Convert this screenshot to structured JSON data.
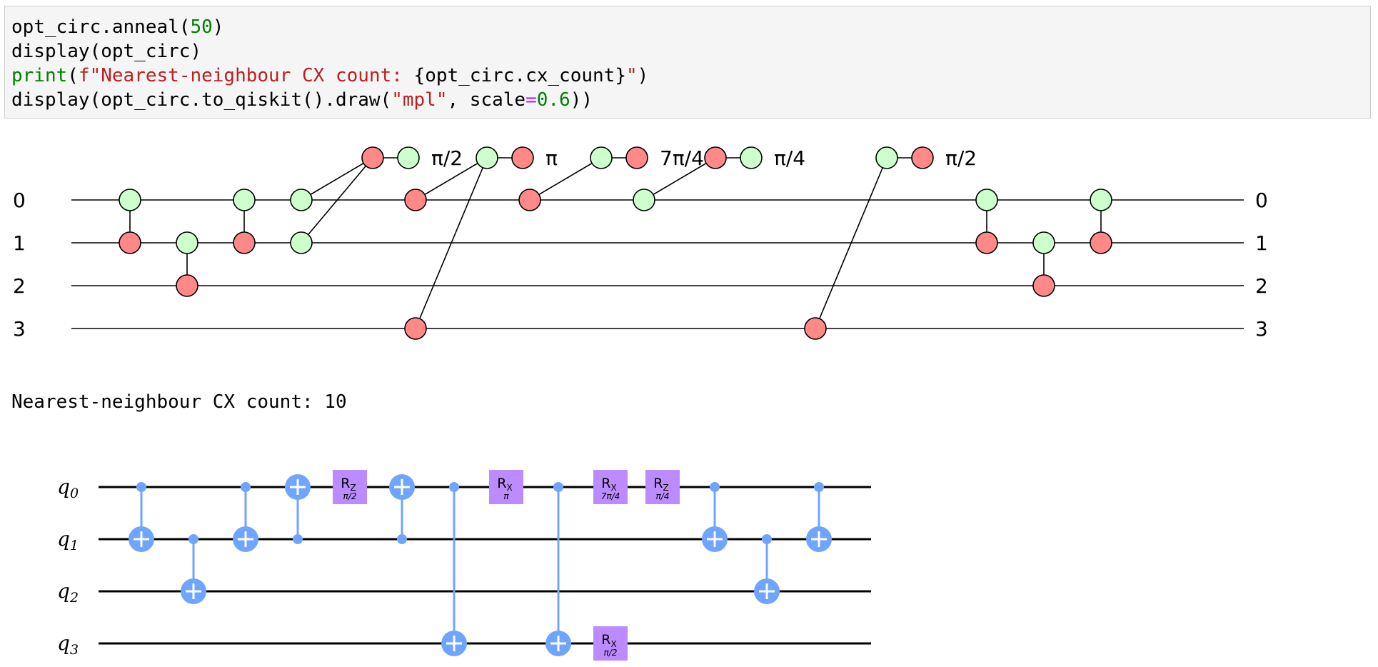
{
  "code_cell": {
    "lines": [
      [
        {
          "t": "opt_circ.anneal(",
          "c": ""
        },
        {
          "t": "50",
          "c": "tk-green"
        },
        {
          "t": ")",
          "c": ""
        }
      ],
      [
        {
          "t": "display(opt_circ)",
          "c": ""
        }
      ],
      [
        {
          "t": "print",
          "c": "tk-green"
        },
        {
          "t": "(",
          "c": ""
        },
        {
          "t": "f\"Nearest-neighbour CX count: ",
          "c": "tk-red"
        },
        {
          "t": "{",
          "c": ""
        },
        {
          "t": "opt_circ.cx_count",
          "c": ""
        },
        {
          "t": "}",
          "c": ""
        },
        {
          "t": "\"",
          "c": "tk-red"
        },
        {
          "t": ")",
          "c": ""
        }
      ],
      [
        {
          "t": "display(opt_circ.to_qiskit().draw(",
          "c": ""
        },
        {
          "t": "\"mpl\"",
          "c": "tk-red"
        },
        {
          "t": ", scale",
          "c": ""
        },
        {
          "t": "=",
          "c": "tk-purple"
        },
        {
          "t": "0.6",
          "c": "tk-green"
        },
        {
          "t": "))",
          "c": ""
        }
      ]
    ]
  },
  "output_text": "Nearest-neighbour CX count: 10",
  "colors": {
    "z_spider": "#ff8888",
    "x_spider": "#ccffcc",
    "qiskit_cx": "#6fa4ff",
    "qiskit_rot": "#bb8bff"
  },
  "zx_diagram": {
    "wire_labels_left": [
      "0",
      "1",
      "2",
      "3"
    ],
    "wire_labels_right": [
      "0",
      "1",
      "2",
      "3"
    ],
    "cx_gates": [
      {
        "col": 0,
        "ctrl": 0,
        "tgt": 1
      },
      {
        "col": 1,
        "ctrl": 1,
        "tgt": 2
      },
      {
        "col": 2,
        "ctrl": 0,
        "tgt": 1
      },
      {
        "col": 15,
        "ctrl": 0,
        "tgt": 1
      },
      {
        "col": 16,
        "ctrl": 1,
        "tgt": 2
      },
      {
        "col": 17,
        "ctrl": 0,
        "tgt": 1
      }
    ],
    "phase_gadgets": [
      {
        "phase": "π/2",
        "legs": [
          {
            "col": 3,
            "wire": 0,
            "type": "x"
          },
          {
            "col": 3,
            "wire": 1,
            "type": "x"
          }
        ]
      },
      {
        "phase": "π",
        "legs": [
          {
            "col": 5,
            "wire": 0,
            "type": "z"
          },
          {
            "col": 5,
            "wire": 3,
            "type": "z"
          }
        ]
      },
      {
        "phase": "7π/4",
        "legs": [
          {
            "col": 7,
            "wire": 0,
            "type": "z"
          }
        ]
      },
      {
        "phase": "π/4",
        "legs": [
          {
            "col": 9,
            "wire": 0,
            "type": "x"
          }
        ]
      },
      {
        "phase": "π/2",
        "legs": [
          {
            "col": 12,
            "wire": 3,
            "type": "z"
          }
        ]
      }
    ]
  },
  "qiskit_circuit": {
    "qubit_labels": [
      {
        "base": "q",
        "sub": "0"
      },
      {
        "base": "q",
        "sub": "1"
      },
      {
        "base": "q",
        "sub": "2"
      },
      {
        "base": "q",
        "sub": "3"
      }
    ],
    "gates": [
      {
        "type": "cx",
        "col": 0,
        "ctrl": 0,
        "tgt": 1
      },
      {
        "type": "cx",
        "col": 1,
        "ctrl": 1,
        "tgt": 2
      },
      {
        "type": "cx",
        "col": 2,
        "ctrl": 0,
        "tgt": 1
      },
      {
        "type": "cx",
        "col": 3,
        "ctrl": 1,
        "tgt": 0
      },
      {
        "type": "rot",
        "col": 4,
        "wire": 0,
        "name": "R",
        "axis": "Z",
        "param": "π/2"
      },
      {
        "type": "cx",
        "col": 5,
        "ctrl": 1,
        "tgt": 0
      },
      {
        "type": "cx",
        "col": 6,
        "ctrl": 0,
        "tgt": 3
      },
      {
        "type": "rot",
        "col": 7,
        "wire": 0,
        "name": "R",
        "axis": "X",
        "param": "π"
      },
      {
        "type": "cx",
        "col": 8,
        "ctrl": 0,
        "tgt": 3
      },
      {
        "type": "rot",
        "col": 9,
        "wire": 0,
        "name": "R",
        "axis": "X",
        "param": "7π/4"
      },
      {
        "type": "rot",
        "col": 9,
        "wire": 3,
        "name": "R",
        "axis": "X",
        "param": "π/2"
      },
      {
        "type": "rot",
        "col": 10,
        "wire": 0,
        "name": "R",
        "axis": "Z",
        "param": "π/4"
      },
      {
        "type": "cx",
        "col": 11,
        "ctrl": 0,
        "tgt": 1
      },
      {
        "type": "cx",
        "col": 12,
        "ctrl": 1,
        "tgt": 2
      },
      {
        "type": "cx",
        "col": 13,
        "ctrl": 0,
        "tgt": 1
      }
    ]
  }
}
